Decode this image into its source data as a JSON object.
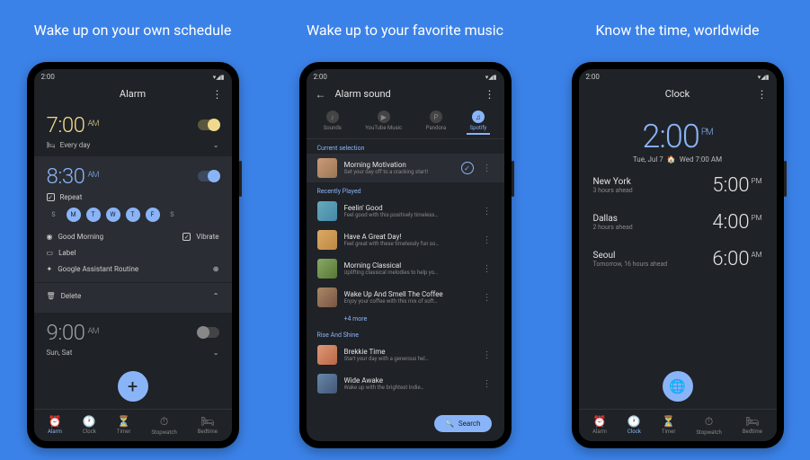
{
  "panels": [
    {
      "title": "Wake up on your own schedule"
    },
    {
      "title": "Wake up to your favorite music"
    },
    {
      "title": "Know the time, worldwide"
    }
  ],
  "status_time": "2:00",
  "screen1": {
    "header": "Alarm",
    "alarms": [
      {
        "time": "7:00",
        "ampm": "AM",
        "schedule": "Every day",
        "on": true,
        "icon": "bed"
      },
      {
        "time": "8:30",
        "ampm": "AM",
        "on": true,
        "repeat_label": "Repeat",
        "days": [
          "S",
          "M",
          "T",
          "W",
          "T",
          "F",
          "S"
        ],
        "days_active": [
          false,
          true,
          true,
          true,
          true,
          true,
          false
        ],
        "tone": "Good Morning",
        "vibrate": "Vibrate",
        "label": "Label",
        "assistant": "Google Assistant Routine",
        "delete": "Delete"
      },
      {
        "time": "9:00",
        "ampm": "AM",
        "schedule": "Sun, Sat",
        "on": false
      }
    ],
    "nav": [
      "Alarm",
      "Clock",
      "Timer",
      "Stopwatch",
      "Bedtime"
    ],
    "nav_active": 0
  },
  "screen2": {
    "header": "Alarm sound",
    "tabs": [
      "Sounds",
      "YouTube Music",
      "Pandora",
      "Spotify"
    ],
    "tab_active": 3,
    "sections": {
      "current": {
        "label": "Current selection",
        "track": {
          "title": "Morning Motivation",
          "sub": "Get your day off to a cracking start!"
        }
      },
      "recent": {
        "label": "Recently Played",
        "tracks": [
          {
            "title": "Feelin' Good",
            "sub": "Feel good with this positively timeless…"
          },
          {
            "title": "Have A Great Day!",
            "sub": "Feel great with these timelessly fun so…"
          },
          {
            "title": "Morning Classical",
            "sub": "Uplifting classical melodies to help yo…"
          },
          {
            "title": "Wake Up And Smell The Coffee",
            "sub": "Enjoy your coffee with this mix of soft…"
          }
        ],
        "more": "+4 more"
      },
      "rise": {
        "label": "Rise And Shine",
        "tracks": [
          {
            "title": "Brekkie Time",
            "sub": "Start your day with a generous hel…"
          },
          {
            "title": "Wide Awake",
            "sub": "Wake up with the brightest Indie…"
          }
        ]
      }
    },
    "search": "Search"
  },
  "screen3": {
    "header": "Clock",
    "time": "2:00",
    "ampm": "PM",
    "date": "Tue, Jul 7",
    "home_icon": "home",
    "home_time": "Wed 7:00 AM",
    "cities": [
      {
        "name": "New York",
        "offset": "3 hours ahead",
        "time": "5:00",
        "ampm": "PM"
      },
      {
        "name": "Dallas",
        "offset": "2 hours ahead",
        "time": "4:00",
        "ampm": "PM"
      },
      {
        "name": "Seoul",
        "offset": "Tomorrow, 16 hours ahead",
        "time": "6:00",
        "ampm": "AM"
      }
    ],
    "nav": [
      "Alarm",
      "Clock",
      "Timer",
      "Stopwatch",
      "Bedtime"
    ],
    "nav_active": 1
  }
}
